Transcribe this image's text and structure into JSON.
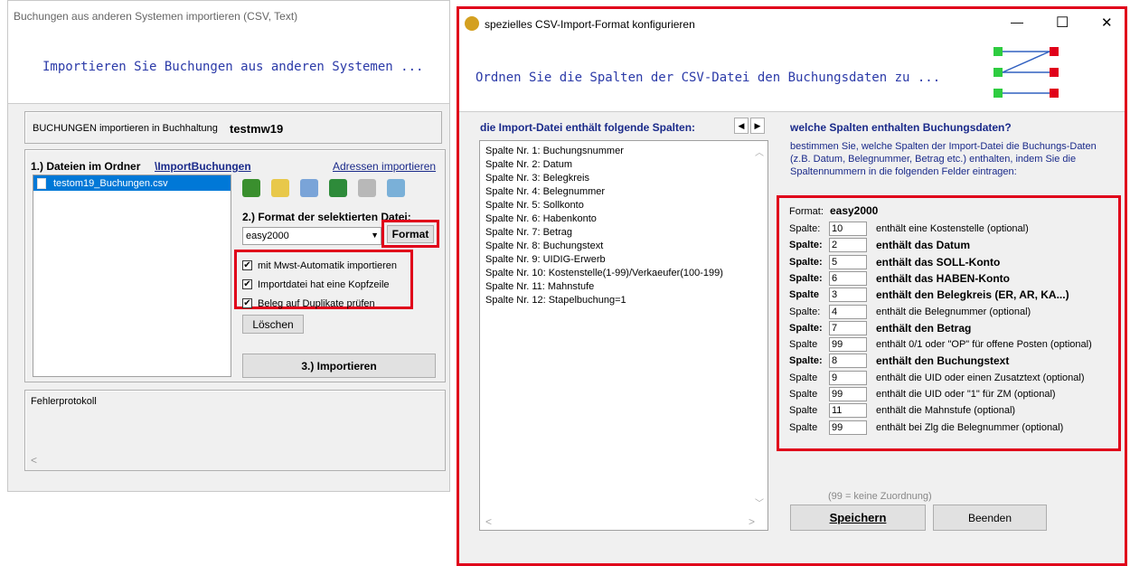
{
  "left_window": {
    "title": "Buchungen aus anderen Systemen importieren (CSV, Text)",
    "header_text": "Importieren Sie Buchungen aus anderen Systemen ...",
    "buchhaltung_label": "BUCHUNGEN importieren in Buchhaltung",
    "buchhaltung_name": "testmw19",
    "folder_label": "1.) Dateien im Ordner",
    "folder_link": "\\ImportBuchungen",
    "address_link": "Adressen importieren",
    "files": [
      "testom19_Buchungen.csv"
    ],
    "format_label": "2.) Format der selektierten Datei:",
    "format_value": "easy2000",
    "format_button": "Format",
    "checkboxes": [
      {
        "label": "mit Mwst-Automatik importieren",
        "checked": true
      },
      {
        "label": "Importdatei hat eine Kopfzeile",
        "checked": true
      },
      {
        "label": "Beleg auf Duplikate prüfen",
        "checked": true
      }
    ],
    "delete_button": "Löschen",
    "import_button": "3.) Importieren",
    "error_label": "Fehlerprotokoll",
    "scroll_left": "<"
  },
  "right_window": {
    "title": "spezielles CSV-Import-Format konfigurieren",
    "header_text": "Ordnen Sie die Spalten der CSV-Datei den Buchungsdaten zu ...",
    "columns_heading": "die Import-Datei enthält folgende Spalten:",
    "columns": [
      "Spalte Nr. 1: Buchungsnummer",
      "Spalte Nr. 2: Datum",
      "Spalte Nr. 3: Belegkreis",
      "Spalte Nr. 4: Belegnummer",
      "Spalte Nr. 5: Sollkonto",
      "Spalte Nr. 6: Habenkonto",
      "Spalte Nr. 7: Betrag",
      "Spalte Nr. 8: Buchungstext",
      "Spalte Nr. 9: UIDIG-Erwerb",
      "Spalte Nr. 10: Kostenstelle(1-99)/Verkaeufer(100-199)",
      "Spalte Nr. 11: Mahnstufe",
      "Spalte Nr. 12: Stapelbuchung=1"
    ],
    "mapping_heading": "welche Spalten enthalten Buchungsdaten?",
    "mapping_description": "bestimmen Sie, welche Spalten der Import-Datei die Buchungs-Daten (z.B. Datum, Belegnummer, Betrag etc.) enthalten, indem Sie die Spaltennummern in die folgenden Felder eintragen:",
    "format_label": "Format:",
    "format_name": "easy2000",
    "mappings": [
      {
        "label": "Spalte:",
        "value": "10",
        "text": "enthält eine Kostenstelle (optional)",
        "bold": false
      },
      {
        "label": "Spalte:",
        "value": "2",
        "text": "enthält das Datum",
        "bold": true
      },
      {
        "label": "Spalte:",
        "value": "5",
        "text": "enthält das SOLL-Konto",
        "bold": true
      },
      {
        "label": "Spalte:",
        "value": "6",
        "text": "enthält das HABEN-Konto",
        "bold": true
      },
      {
        "label": "Spalte",
        "value": "3",
        "text": "enthält den Belegkreis (ER, AR, KA...)",
        "bold": true
      },
      {
        "label": "Spalte:",
        "value": "4",
        "text": "enthält die Belegnummer (optional)",
        "bold": false
      },
      {
        "label": "Spalte:",
        "value": "7",
        "text": "enthält den Betrag",
        "bold": true
      },
      {
        "label": "Spalte",
        "value": "99",
        "text": "enthält 0/1 oder \"OP\" für offene Posten (optional)",
        "bold": false
      },
      {
        "label": "Spalte:",
        "value": "8",
        "text": "enthält den Buchungstext",
        "bold": true
      },
      {
        "label": "Spalte",
        "value": "9",
        "text": "enthält die UID oder einen Zusatztext (optional)",
        "bold": false
      },
      {
        "label": "Spalte",
        "value": "99",
        "text": "enthält die UID oder \"1\" für ZM (optional)",
        "bold": false
      },
      {
        "label": "Spalte",
        "value": "11",
        "text": "enthält die Mahnstufe (optional)",
        "bold": false
      },
      {
        "label": "Spalte",
        "value": "99",
        "text": "enthält bei Zlg die Belegnummer (optional)",
        "bold": false
      }
    ],
    "hint": "(99 = keine Zuordnung)",
    "save_button": "Speichern",
    "close_button": "Beenden",
    "nav_left": "◀",
    "nav_right": "▶",
    "minimize": "—",
    "maximize": "☐",
    "close": "✕"
  },
  "colors": {
    "accent_red": "#e0001a",
    "header_blue": "#2b3aa8",
    "selection_blue": "#0078d7"
  }
}
